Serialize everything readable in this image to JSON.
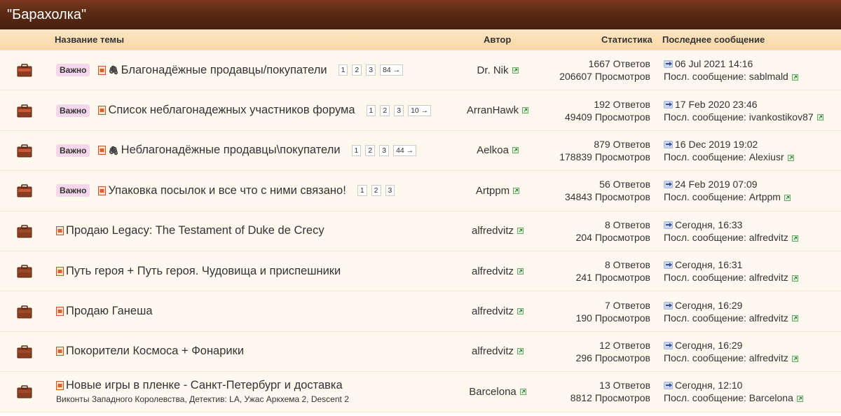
{
  "forum": {
    "title": "\"Барахолка\""
  },
  "columns": {
    "topic": "Название темы",
    "author": "Автор",
    "stats": "Статистика",
    "last": "Последнее сообщение"
  },
  "colors": {
    "header_bar": "#5a2a14",
    "row_bg": "#fff8ee",
    "badge_bg": "#f5d6ea"
  },
  "topics": [
    {
      "sticky": true,
      "badge": "Важно",
      "attachment": true,
      "title": "Благонадёжные продавцы/покупатели",
      "pages": [
        "1",
        "2",
        "3",
        "84 →"
      ],
      "subtitle": "",
      "author": "Dr. Nik",
      "replies": "1667 Ответов",
      "views": "206607 Просмотров",
      "last_date": "06 Jul 2021 14:16",
      "last_by": "Посл. сообщение: sablmald"
    },
    {
      "sticky": true,
      "badge": "Важно",
      "attachment": false,
      "title": "Список неблагонадежных участников форума",
      "pages": [
        "1",
        "2",
        "3",
        "10 →"
      ],
      "subtitle": "",
      "author": "ArranHawk",
      "replies": "192 Ответов",
      "views": "49409 Просмотров",
      "last_date": "17 Feb 2020 23:46",
      "last_by": "Посл. сообщение: ivankostikov87"
    },
    {
      "sticky": true,
      "badge": "Важно",
      "attachment": true,
      "title": "Неблагонадёжные продавцы\\покупатели",
      "pages": [
        "1",
        "2",
        "3",
        "44 →"
      ],
      "subtitle": "",
      "author": "Aelkoa",
      "replies": "879 Ответов",
      "views": "178839 Просмотров",
      "last_date": "16 Dec 2019 19:02",
      "last_by": "Посл. сообщение: Alexiusr"
    },
    {
      "sticky": true,
      "badge": "Важно",
      "attachment": false,
      "title": "Упаковка посылок и все что с ними связано!",
      "pages": [
        "1",
        "2",
        "3"
      ],
      "subtitle": "",
      "author": "Artppm",
      "replies": "56 Ответов",
      "views": "34843 Просмотров",
      "last_date": "24 Feb 2019 07:09",
      "last_by": "Посл. сообщение: Artppm"
    },
    {
      "sticky": false,
      "badge": "",
      "attachment": false,
      "title": "Продаю Legacy: The Testament of Duke de Crecy",
      "pages": [],
      "subtitle": "",
      "author": "alfredvitz",
      "replies": "8 Ответов",
      "views": "204 Просмотров",
      "last_date": "Сегодня, 16:33",
      "last_by": "Посл. сообщение: alfredvitz"
    },
    {
      "sticky": false,
      "badge": "",
      "attachment": false,
      "title": "Путь героя + Путь героя. Чудовища и приспешники",
      "pages": [],
      "subtitle": "",
      "author": "alfredvitz",
      "replies": "8 Ответов",
      "views": "241 Просмотров",
      "last_date": "Сегодня, 16:31",
      "last_by": "Посл. сообщение: alfredvitz"
    },
    {
      "sticky": false,
      "badge": "",
      "attachment": false,
      "title": "Продаю Ганеша",
      "pages": [],
      "subtitle": "",
      "author": "alfredvitz",
      "replies": "7 Ответов",
      "views": "190 Просмотров",
      "last_date": "Сегодня, 16:29",
      "last_by": "Посл. сообщение: alfredvitz"
    },
    {
      "sticky": false,
      "badge": "",
      "attachment": false,
      "title": "Покорители Космоса + Фонарики",
      "pages": [],
      "subtitle": "",
      "author": "alfredvitz",
      "replies": "12 Ответов",
      "views": "296 Просмотров",
      "last_date": "Сегодня, 16:29",
      "last_by": "Посл. сообщение: alfredvitz"
    },
    {
      "sticky": false,
      "badge": "",
      "attachment": false,
      "title": "Новые игры в пленке - Санкт-Петербург и доставка",
      "pages": [],
      "subtitle": "Виконты Западного Королевства, Детектив: LA, Ужас Аркхема 2, Descent 2",
      "author": "Barcelona",
      "replies": "13 Ответов",
      "views": "8812 Просмотров",
      "last_date": "Сегодня, 12:10",
      "last_by": "Посл. сообщение: Barcelona"
    }
  ]
}
